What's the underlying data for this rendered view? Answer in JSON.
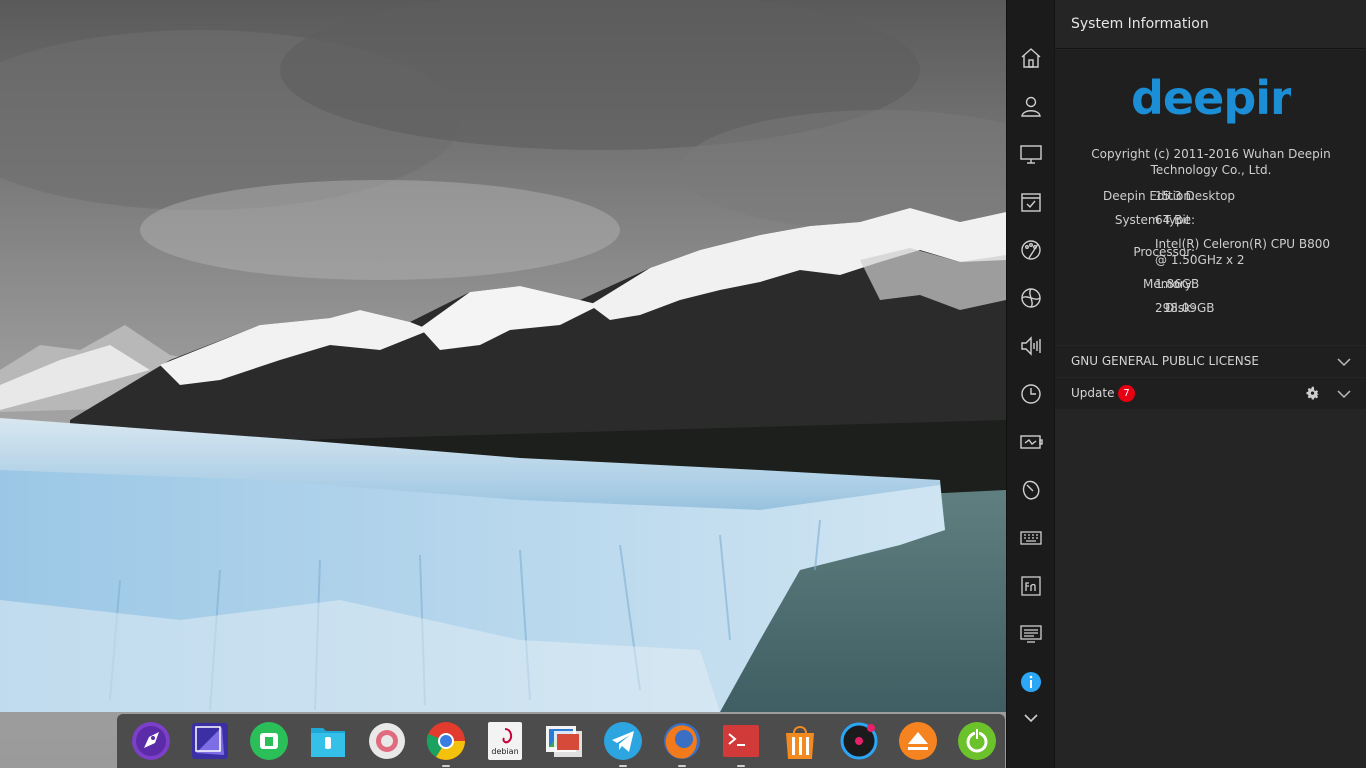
{
  "panel": {
    "title": "System Information",
    "logo_text": "deepin",
    "copyright": "Copyright (c) 2011-2016 Wuhan Deepin Technology Co., Ltd.",
    "info": [
      {
        "key": "Deepin Edition:",
        "value": "15.3 Desktop"
      },
      {
        "key": "System Type:",
        "value": "64 Bit"
      },
      {
        "key": "Processor:",
        "value": "Intel(R) Celeron(R) CPU B800 @ 1.50GHz x 2"
      },
      {
        "key": "Memory:",
        "value": "1.86GB"
      },
      {
        "key": "Disk:",
        "value": "298.09GB"
      }
    ],
    "license_label": "GNU GENERAL PUBLIC LICENSE",
    "update_label": "Update",
    "update_count": "7"
  },
  "nav_items": [
    "home-icon",
    "accounts-icon",
    "display-icon",
    "default-apps-icon",
    "personalization-icon",
    "network-icon",
    "sound-icon",
    "time-icon",
    "power-icon",
    "mouse-icon",
    "keyboard-icon",
    "shortcuts-icon",
    "system-info-icon"
  ],
  "dock_items": [
    "launcher",
    "deepin-screenshot",
    "deepin-store-green",
    "file-manager",
    "control-center",
    "chromium",
    "debian",
    "image-viewer",
    "telegram",
    "firefox",
    "terminal",
    "software-center",
    "deepin-music",
    "updater",
    "power-manager"
  ],
  "colors": {
    "accent": "#2ca7f8",
    "badge": "#e60012",
    "logo": "#1b8ed6"
  }
}
